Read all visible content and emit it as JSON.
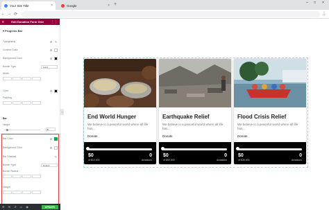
{
  "browser": {
    "tabs": [
      {
        "label": "Your Site Title",
        "active": true
      },
      {
        "label": "Google",
        "active": false
      }
    ],
    "new_tab": "+",
    "close_glyph": "×",
    "window_controls": [
      "–",
      "□",
      "×"
    ]
  },
  "panel": {
    "header_title": "Edit Donation Form Grid",
    "section_title": "Progress Bar",
    "top_fields": {
      "typography": "Typography",
      "content_color": "Content Color",
      "background_color": "Background Color",
      "border_type": "Border Type",
      "border_type_value": "Solid",
      "width": "Width",
      "color": "Color",
      "padding": "Padding"
    },
    "bar_section": {
      "title": "Bar",
      "height": "Height",
      "height_value": "5",
      "bar_color": "Bar Color",
      "background_color": "Background Color",
      "bar_shadow": "Bar Shadow",
      "border_type": "Border Type",
      "border_type_value": "Default",
      "border_radius": "Border Radius",
      "margin": "Margin"
    },
    "footer": {
      "update_label": "UPDATE"
    }
  },
  "cards": [
    {
      "title": "End World Hunger",
      "description": "We believe in a peaceful world where all life has...",
      "donate": "Donate",
      "amount": "$0",
      "goal": "of $10,000",
      "donations": "0",
      "donations_label": "donations",
      "progress": 0
    },
    {
      "title": "Earthquake Relief",
      "description": "We believe in a peaceful world where all life has...",
      "donate": "Donate",
      "amount": "$0",
      "goal": "of $50,000",
      "donations": "0",
      "donations_label": "donations",
      "progress": 0
    },
    {
      "title": "Flood Crisis Relief",
      "description": "We believe in a peaceful world where all life has...",
      "donate": "Donate",
      "amount": "$0",
      "goal": "of $35,000",
      "donations": "0",
      "donations_label": "donations",
      "progress": 0
    }
  ],
  "colors": {
    "panel_header": "#93003c",
    "bar_color": "#18a34b",
    "update_button": "#39b54a",
    "highlight_border": "#e8383d"
  },
  "icons": {
    "back": "←",
    "forward": "→",
    "reload": "⟳",
    "menu": "⋮"
  }
}
